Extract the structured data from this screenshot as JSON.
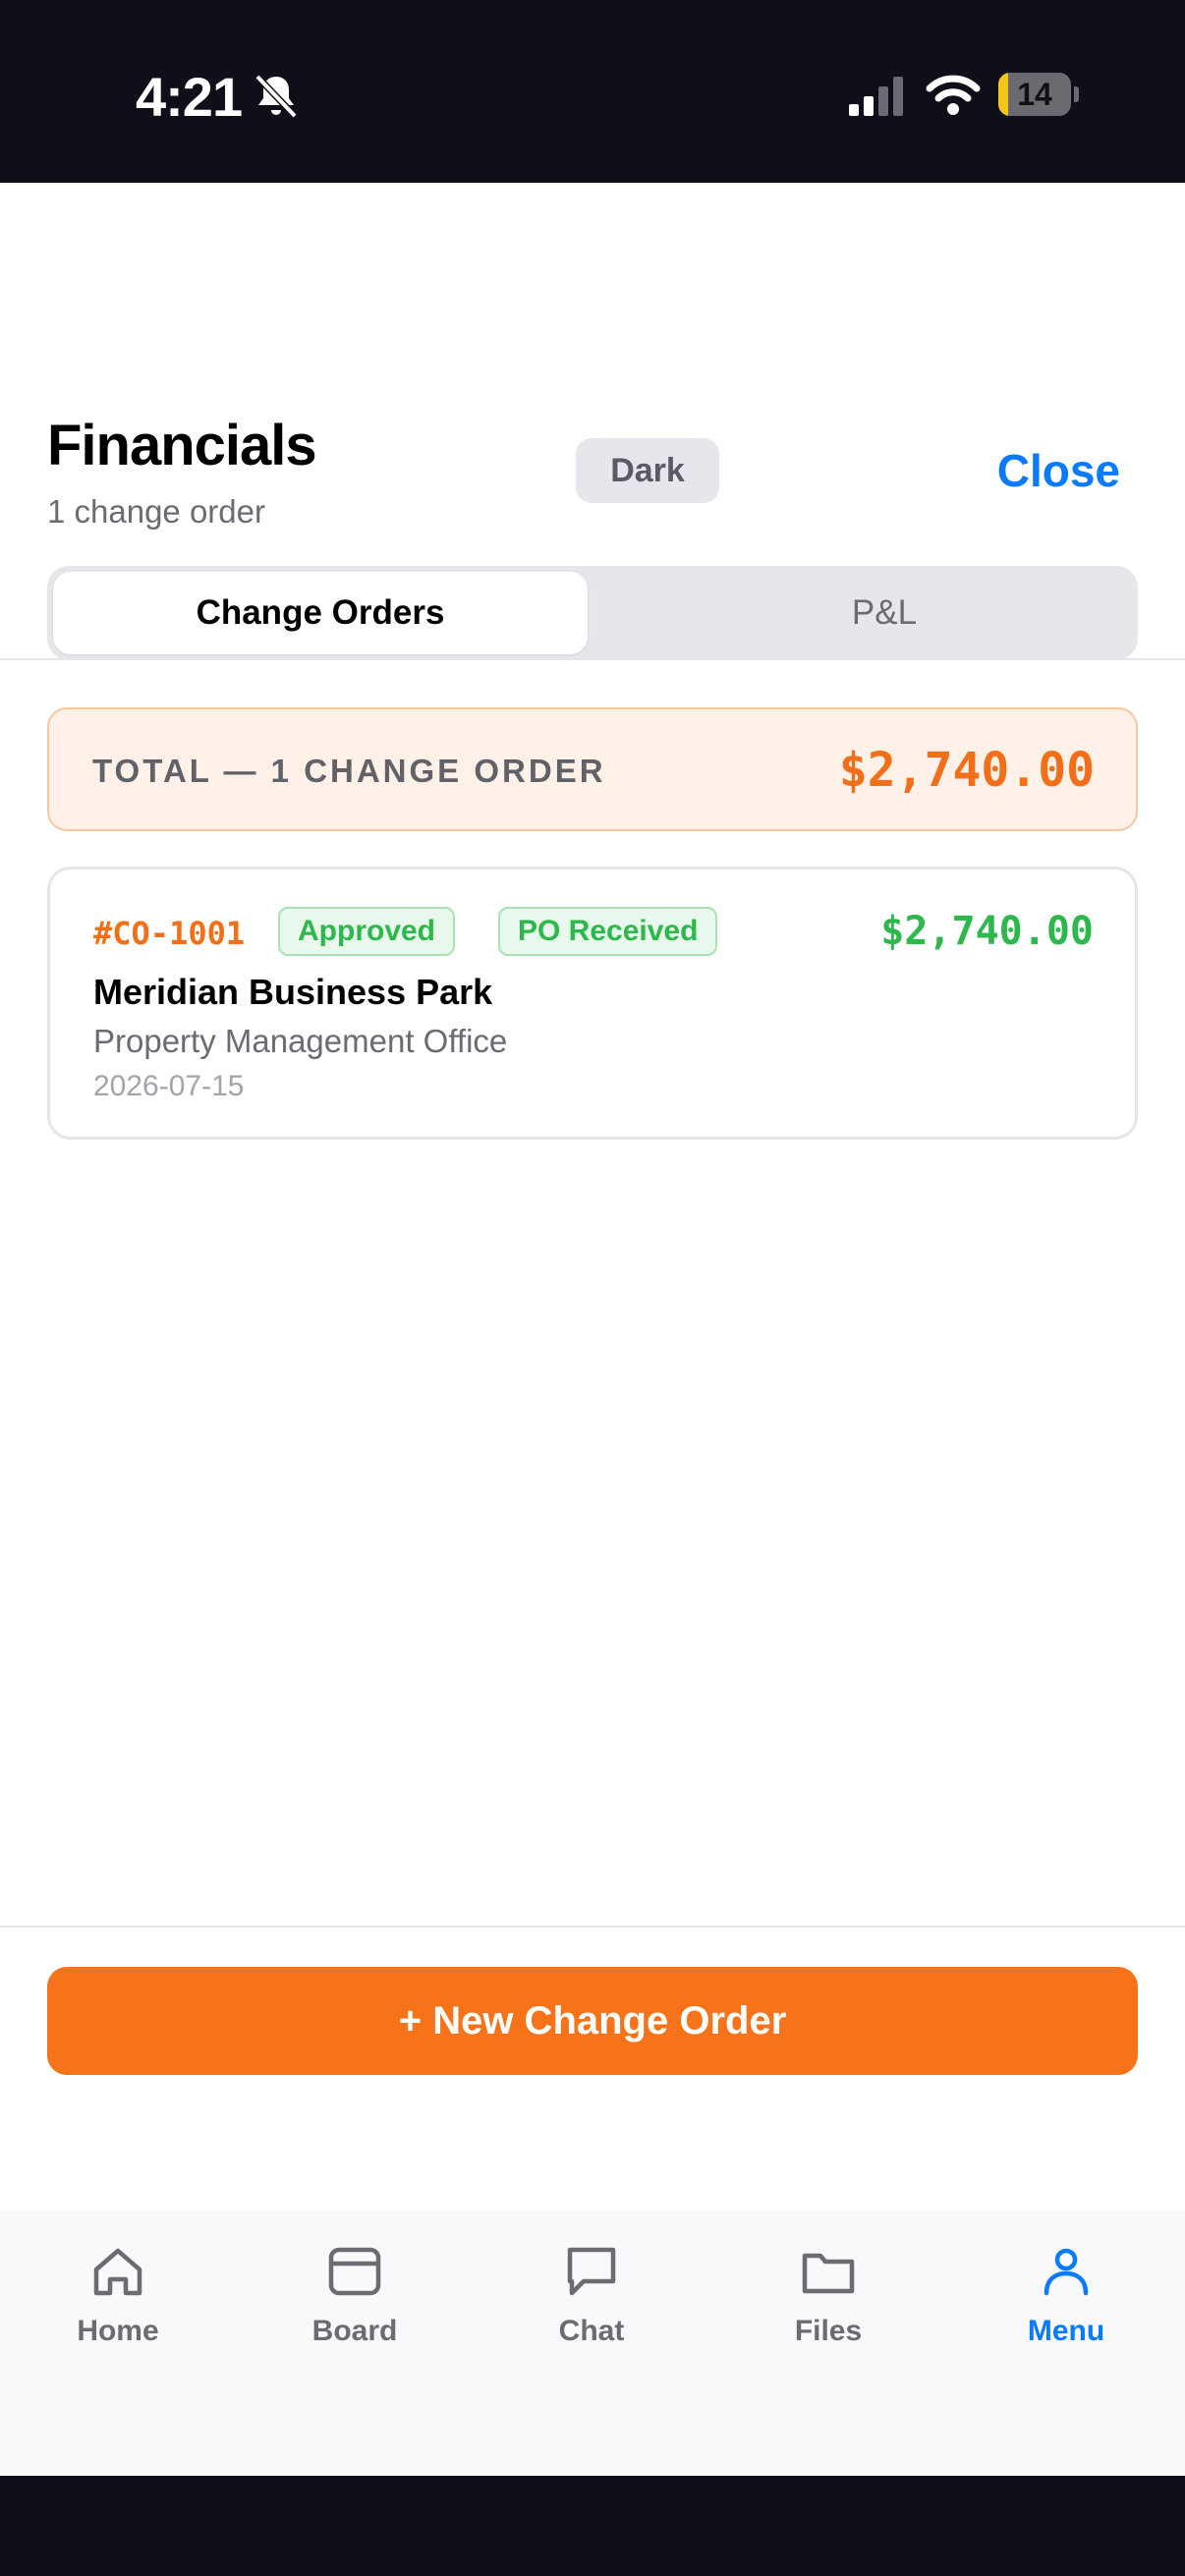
{
  "status_bar": {
    "time": "4:21",
    "battery_level": "14",
    "battery_fraction": 0.14
  },
  "header": {
    "title": "Financials",
    "subtitle": "1 change order",
    "theme_toggle_label": "Dark",
    "close_label": "Close"
  },
  "tabs": [
    {
      "label": "Change Orders",
      "active": true
    },
    {
      "label": "P&L",
      "active": false
    }
  ],
  "total": {
    "label": "TOTAL — 1 CHANGE ORDER",
    "amount": "$2,740.00"
  },
  "change_orders": [
    {
      "number": "#CO-1001",
      "badges": [
        "Approved",
        "PO Received"
      ],
      "amount": "$2,740.00",
      "project": "Meridian Business Park",
      "client": "Property Management Office",
      "date": "2026-07-15"
    }
  ],
  "actions": {
    "new_change_order_label": "+ New Change Order"
  },
  "tab_bar": {
    "items": [
      {
        "label": "Home",
        "icon": "home-icon"
      },
      {
        "label": "Board",
        "icon": "board-icon"
      },
      {
        "label": "Chat",
        "icon": "chat-icon"
      },
      {
        "label": "Files",
        "icon": "folder-icon"
      },
      {
        "label": "Menu",
        "icon": "person-icon",
        "active": true
      }
    ]
  },
  "colors": {
    "accent_orange": "#f7731a",
    "accent_blue": "#0a7aff",
    "success_green": "#2db84c",
    "status_bar_bg": "#0f0f1a"
  }
}
